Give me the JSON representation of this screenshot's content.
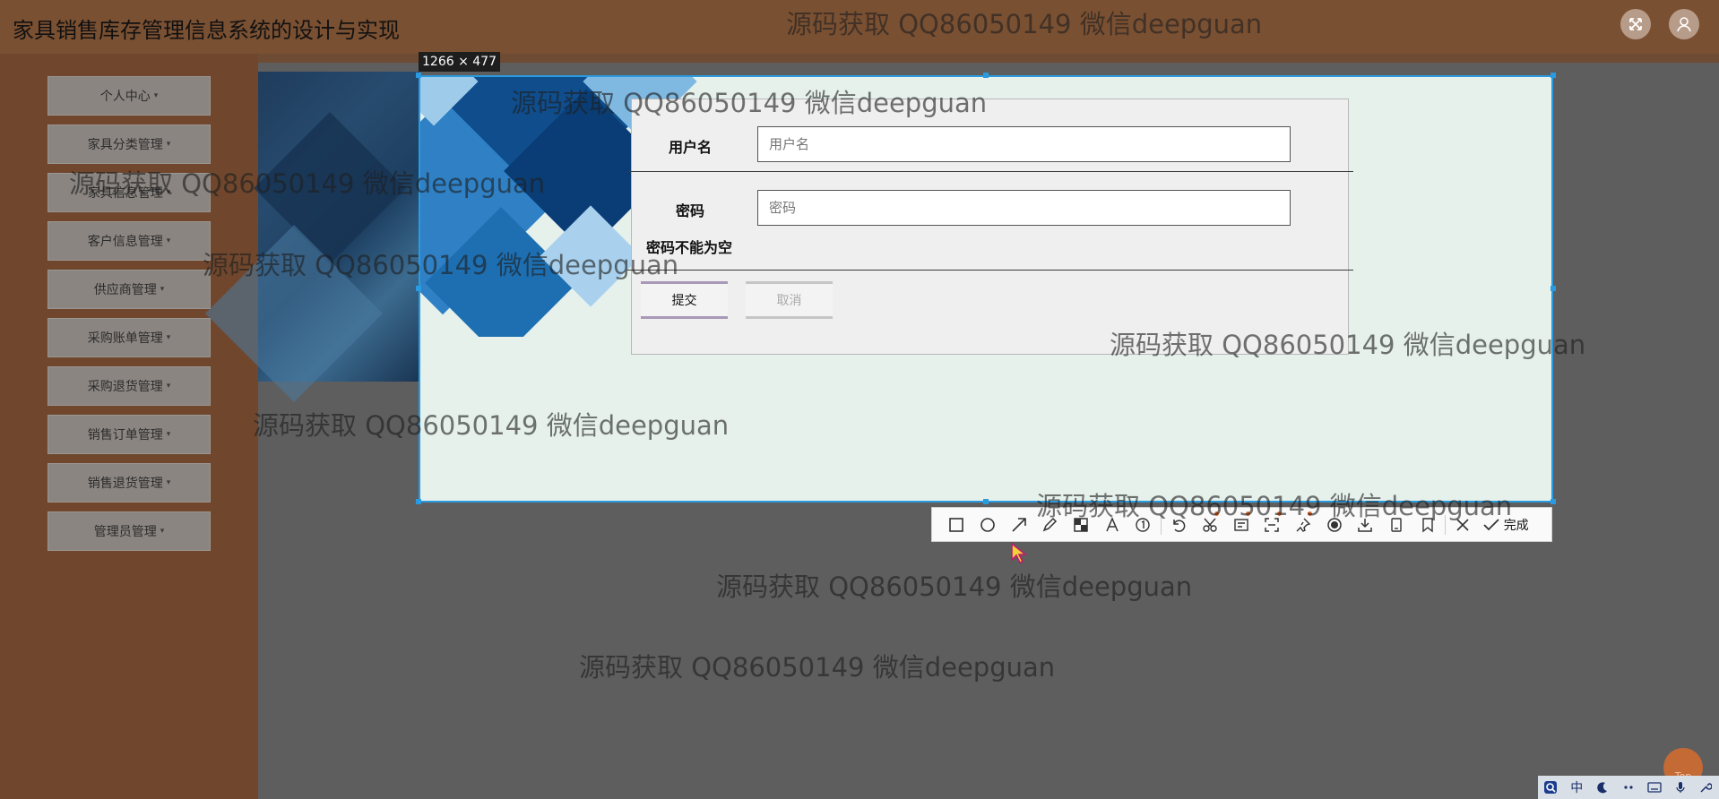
{
  "header": {
    "title": "家具销售库存管理信息系统的设计与实现"
  },
  "sidebar": {
    "items": [
      {
        "label": "个人中心"
      },
      {
        "label": "家具分类管理"
      },
      {
        "label": "家具信息管理"
      },
      {
        "label": "客户信息管理"
      },
      {
        "label": "供应商管理"
      },
      {
        "label": "采购账单管理"
      },
      {
        "label": "采购退货管理"
      },
      {
        "label": "销售订单管理"
      },
      {
        "label": "销售退货管理"
      },
      {
        "label": "管理员管理"
      }
    ],
    "caret": "▾"
  },
  "capture": {
    "size_label": "1266 × 477"
  },
  "form": {
    "username_label": "用户名",
    "username_placeholder": "用户名",
    "password_label": "密码",
    "password_placeholder": "密码",
    "password_error": "密码不能为空",
    "submit_label": "提交",
    "cancel_label": "取消"
  },
  "toolbar": {
    "tools": [
      "rectangle-icon",
      "ellipse-icon",
      "arrow-icon",
      "pen-icon",
      "mosaic-icon",
      "text-icon",
      "number-icon",
      "undo-icon",
      "cut-icon",
      "ocr-icon",
      "scan-icon",
      "pin-icon",
      "record-icon",
      "download-icon",
      "device-icon",
      "bookmark-icon"
    ],
    "done_label": "完成"
  },
  "watermark": "源码获取 QQ86050149 微信deepguan",
  "top_button": "Top",
  "tray": {
    "ime": "中"
  },
  "colors": {
    "accent": "#2a9be0",
    "header": "#7a5032",
    "sidebar": "#70472d",
    "submit_border": "#a899b6"
  }
}
